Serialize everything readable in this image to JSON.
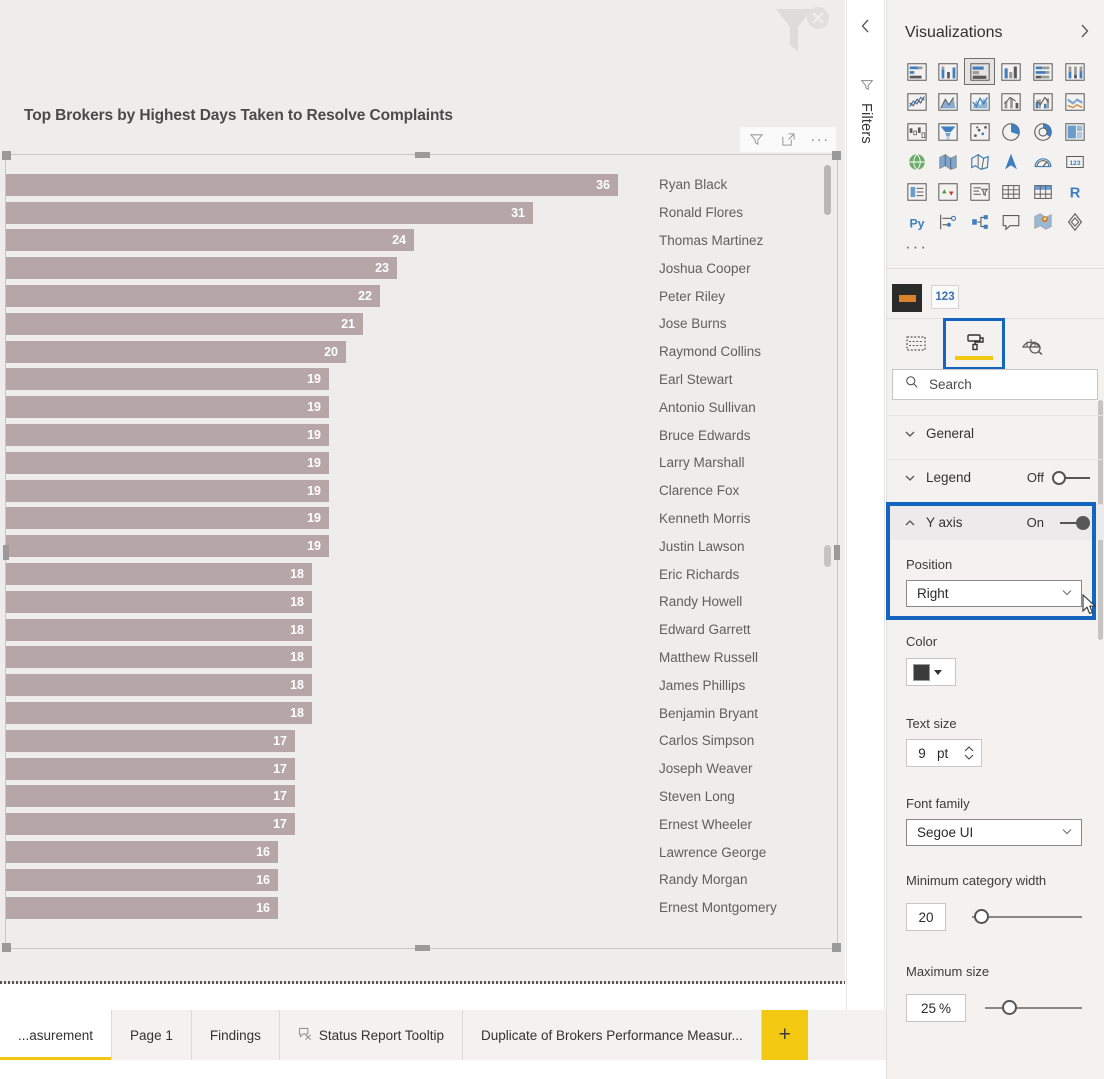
{
  "report": {
    "visual_title": "Top Brokers by Highest Days Taken to Resolve Complaints",
    "header_icons": {
      "filter": "filter-icon",
      "focus": "focus-mode-icon",
      "more": "···"
    },
    "watermark_icon": "clear-filter-watermark-icon"
  },
  "chart_data": {
    "type": "bar",
    "orientation": "horizontal",
    "title": "Top Brokers by Highest Days Taken to Resolve Complaints",
    "xlabel": "",
    "ylabel": "",
    "ylim": [
      0,
      36
    ],
    "grid": false,
    "legend": false,
    "y_axis_position": "Right",
    "categories": [
      "Ryan Black",
      "Ronald Flores",
      "Thomas Martinez",
      "Joshua Cooper",
      "Peter Riley",
      "Jose Burns",
      "Raymond Collins",
      "Earl Stewart",
      "Antonio Sullivan",
      "Bruce Edwards",
      "Larry Marshall",
      "Clarence Fox",
      "Kenneth Morris",
      "Justin Lawson",
      "Eric Richards",
      "Randy Howell",
      "Edward Garrett",
      "Matthew Russell",
      "James Phillips",
      "Benjamin Bryant",
      "Carlos Simpson",
      "Joseph Weaver",
      "Steven Long",
      "Ernest Wheeler",
      "Lawrence George",
      "Randy Morgan",
      "Ernest Montgomery"
    ],
    "values": [
      36,
      31,
      24,
      23,
      22,
      21,
      20,
      19,
      19,
      19,
      19,
      19,
      19,
      19,
      18,
      18,
      18,
      18,
      18,
      18,
      17,
      17,
      17,
      17,
      16,
      16,
      16
    ],
    "bar_color": "#b7a6a8",
    "data_label_color": "#ffffff"
  },
  "filters_pane": {
    "label": "Filters",
    "collapse_icon": "chevron-left-icon",
    "funnel_icon": "filter-icon"
  },
  "visualizations": {
    "title": "Visualizations",
    "expand_icon": "chevron-right-icon",
    "more_visuals": "···",
    "icons": [
      "stacked-bar-chart-icon",
      "stacked-column-chart-icon",
      "clustered-bar-chart-icon",
      "clustered-column-chart-icon",
      "100-percent-stacked-bar-chart-icon",
      "100-percent-stacked-column-chart-icon",
      "line-chart-icon",
      "area-chart-icon",
      "stacked-area-chart-icon",
      "line-and-stacked-column-chart-icon",
      "line-and-clustered-column-chart-icon",
      "ribbon-chart-icon",
      "waterfall-chart-icon",
      "funnel-chart-icon",
      "scatter-chart-icon",
      "pie-chart-icon",
      "donut-chart-icon",
      "treemap-icon",
      "map-icon",
      "filled-map-icon",
      "shape-map-icon",
      "azure-map-icon",
      "gauge-icon",
      "card-icon",
      "multi-row-card-icon",
      "kpi-icon",
      "slicer-icon",
      "table-icon",
      "matrix-icon",
      "r-script-visual-icon",
      "python-visual-icon",
      "key-influencers-icon",
      "decomposition-tree-icon",
      "q-and-a-icon",
      "smart-narrative-icon",
      "paginated-report-icon"
    ],
    "selected_icon_index": 2,
    "swatch_tile": "theme-color-tile-icon",
    "numeric_tile": "123",
    "format_tabs": [
      {
        "name": "fields-tab",
        "icon": "fields-icon",
        "active": false
      },
      {
        "name": "format-tab",
        "icon": "paint-roller-icon",
        "active": true
      },
      {
        "name": "analytics-tab",
        "icon": "analytics-magnifier-icon",
        "active": false
      }
    ],
    "search": {
      "placeholder": "Search",
      "value": "",
      "icon": "search-icon"
    }
  },
  "format_panel": {
    "sections": [
      {
        "label": "General",
        "expanded": false,
        "toggle": null
      },
      {
        "label": "Legend",
        "expanded": false,
        "toggle": {
          "state": "Off",
          "on": false
        }
      },
      {
        "label": "Y axis",
        "expanded": true,
        "toggle": {
          "state": "On",
          "on": true
        }
      }
    ],
    "y_axis": {
      "position_label": "Position",
      "position_value": "Right",
      "color_label": "Color",
      "color_value": "#3b3b3b",
      "text_size_label": "Text size",
      "text_size_value": "9",
      "text_size_unit": "pt",
      "font_family_label": "Font family",
      "font_family_value": "Segoe UI",
      "min_category_width_label": "Minimum category width",
      "min_category_width_value": "20",
      "min_category_width_pct": 8,
      "maximum_size_label": "Maximum size",
      "maximum_size_value": "25",
      "maximum_size_unit": "%",
      "maximum_size_pct": 25
    },
    "highlight_color": "#1565c0"
  },
  "page_tabs": {
    "tabs": [
      {
        "label": "...asurement",
        "active": true,
        "icon": null
      },
      {
        "label": "Page 1",
        "active": false,
        "icon": null
      },
      {
        "label": "Findings",
        "active": false,
        "icon": null
      },
      {
        "label": "Status Report Tooltip",
        "active": false,
        "icon": "tooltip-page-icon"
      },
      {
        "label": "Duplicate of Brokers Performance Measur...",
        "active": false,
        "icon": null
      }
    ],
    "add_label": "+"
  }
}
